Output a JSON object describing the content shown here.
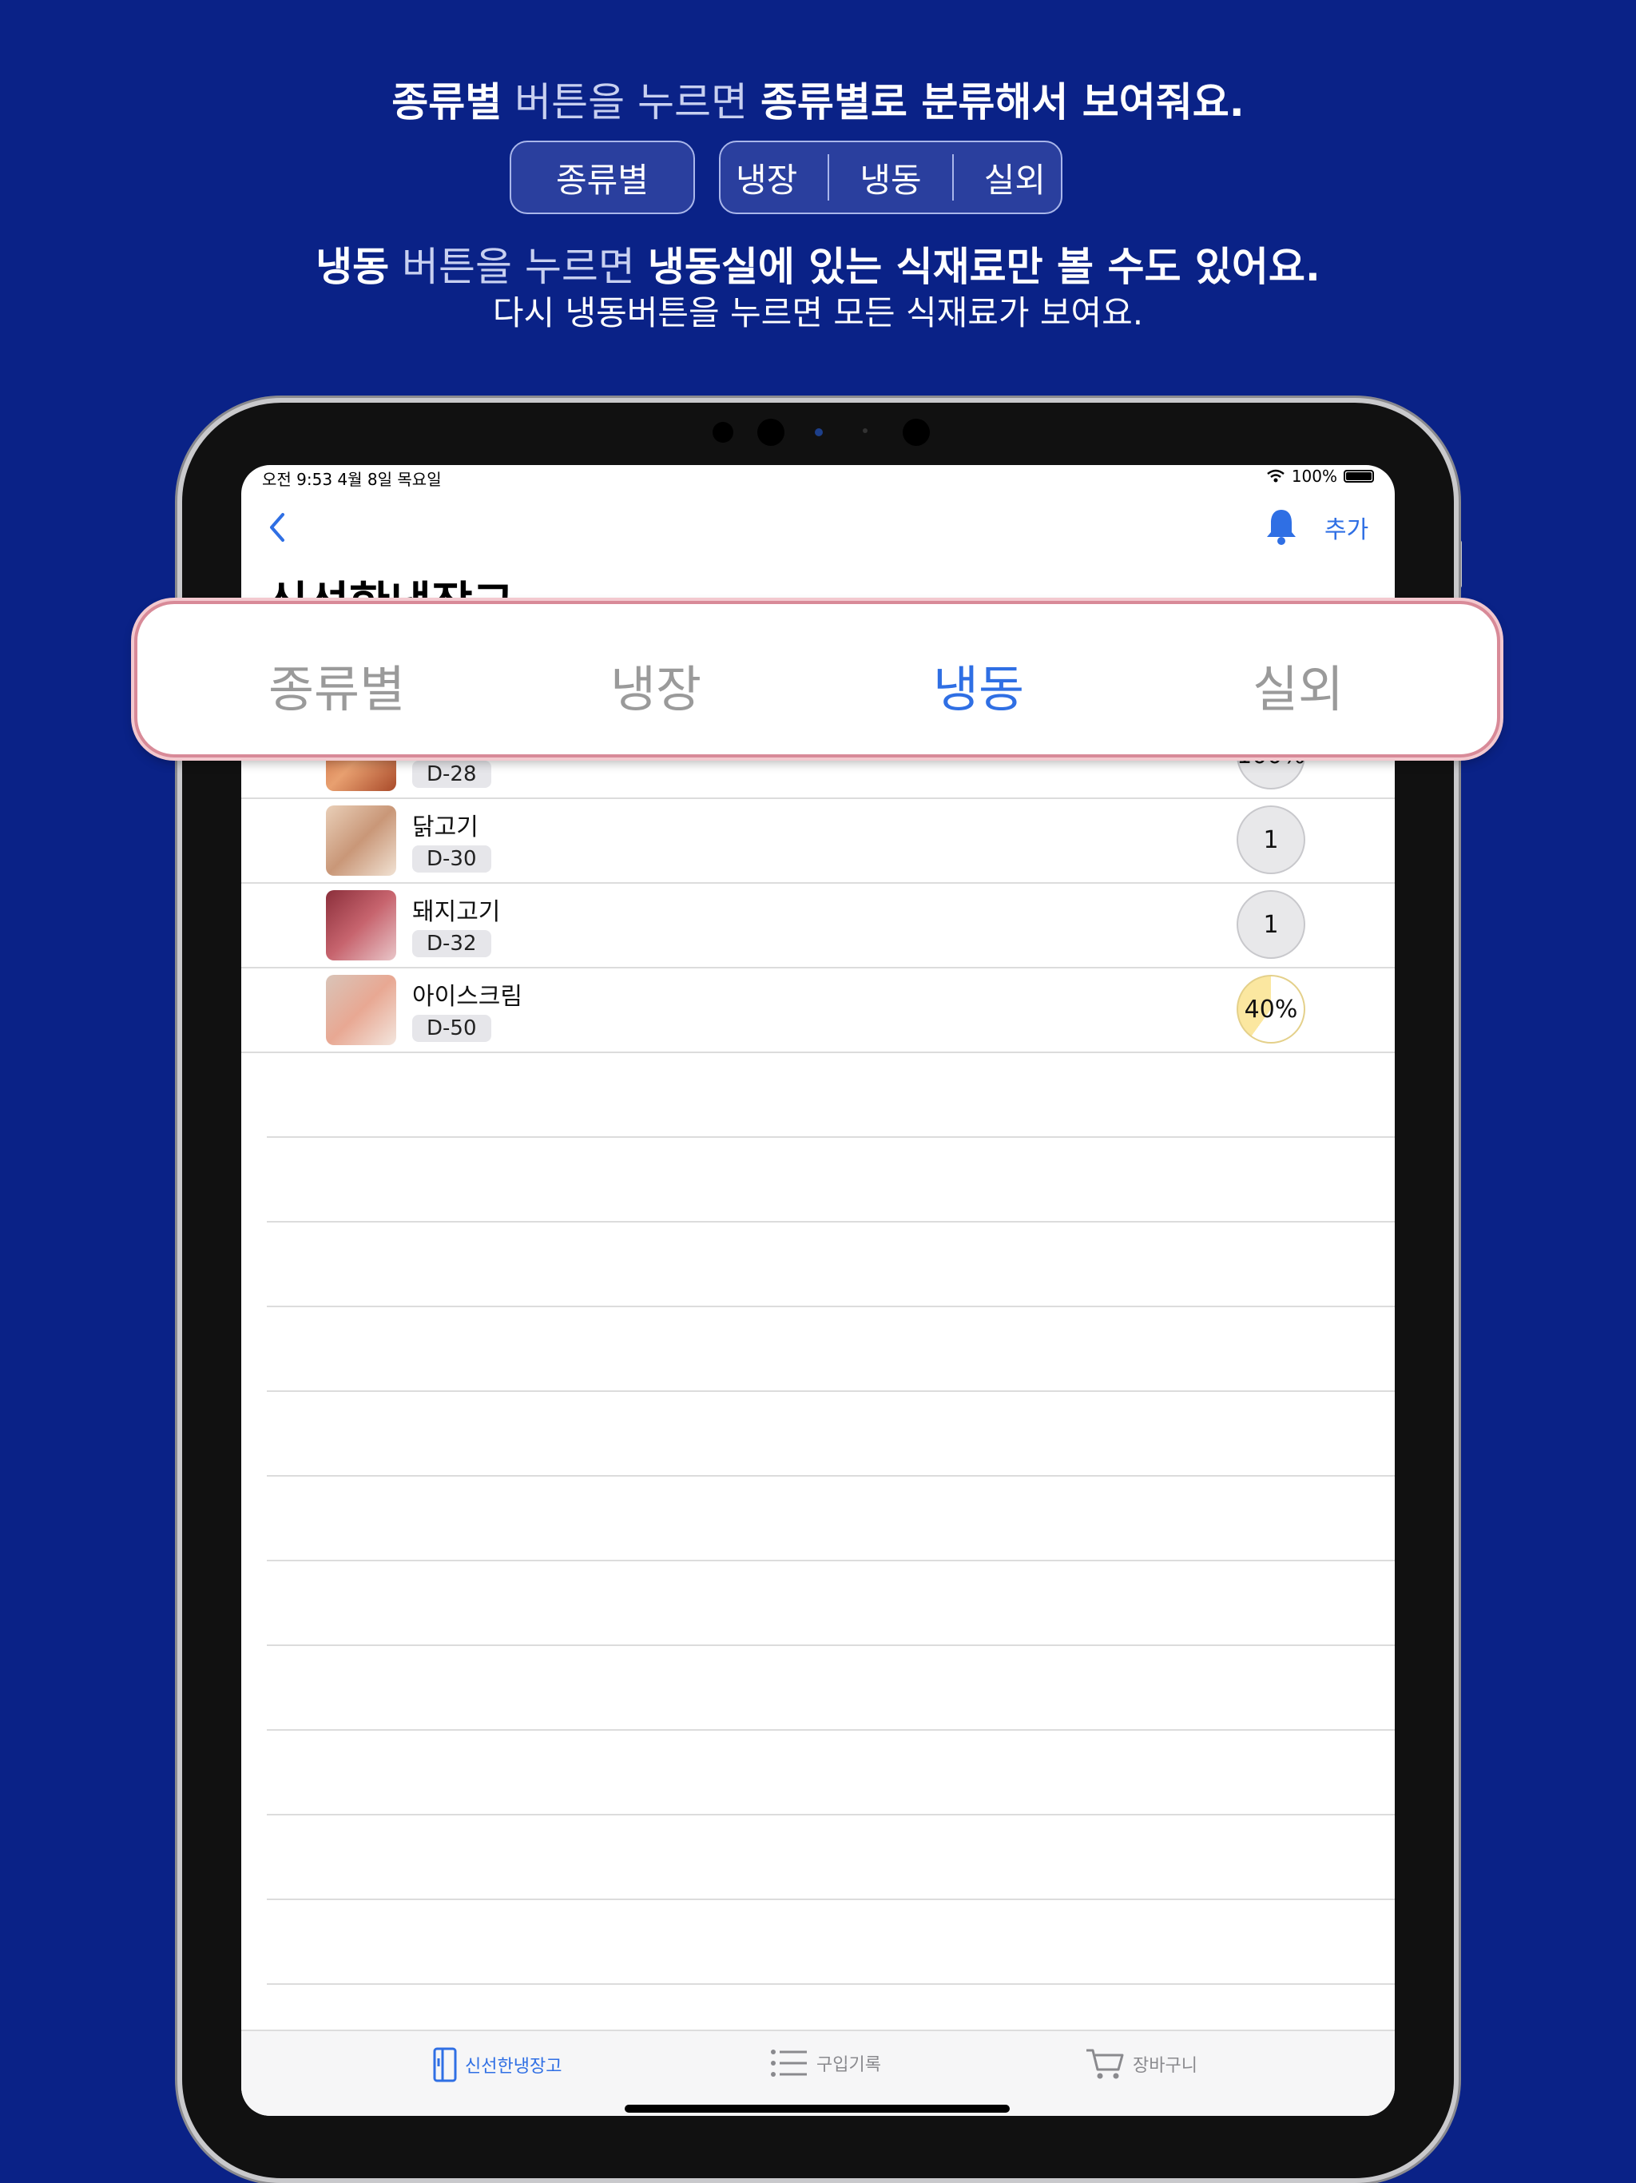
{
  "promo": {
    "line1_bold": "종류별",
    "line1_light": " 버튼을 누르면 ",
    "line1_rest": "종류별로 분류해서 보여줘요.",
    "chip_kind": "종류별",
    "chip_segments": [
      "냉장",
      "냉동",
      "실외"
    ],
    "line3_bold": "냉동",
    "line3_light": " 버튼을 누르면 ",
    "line3_rest": "냉동실에 있는 식재료만 볼 수도 있어요.",
    "line4": "다시 냉동버튼을 누르면 모든 식재료가 보여요."
  },
  "status_bar": {
    "time_date": "오전 9:53   4월 8일 목요일",
    "battery": "100%"
  },
  "nav": {
    "add_label": "추가",
    "title": "신선한냉장고"
  },
  "segmented": {
    "items": [
      "종류별",
      "냉장",
      "냉동",
      "실외"
    ],
    "active": "냉동"
  },
  "items": [
    {
      "name": "",
      "dday": "D-28",
      "badge": "100%"
    },
    {
      "name": "닭고기",
      "dday": "D-30",
      "badge": "1"
    },
    {
      "name": "돼지고기",
      "dday": "D-32",
      "badge": "1"
    },
    {
      "name": "아이스크림",
      "dday": "D-50",
      "badge": "40%",
      "fill": 0.4
    }
  ],
  "tabs": [
    {
      "label": "신선한냉장고",
      "icon": "fridge-icon",
      "active": true
    },
    {
      "label": "구입기록",
      "icon": "list-icon",
      "active": false
    },
    {
      "label": "장바구니",
      "icon": "cart-icon",
      "active": false
    }
  ],
  "colors": {
    "background": "#0a2287",
    "accent": "#2f6fe4",
    "inactive": "#9a9a9a"
  }
}
